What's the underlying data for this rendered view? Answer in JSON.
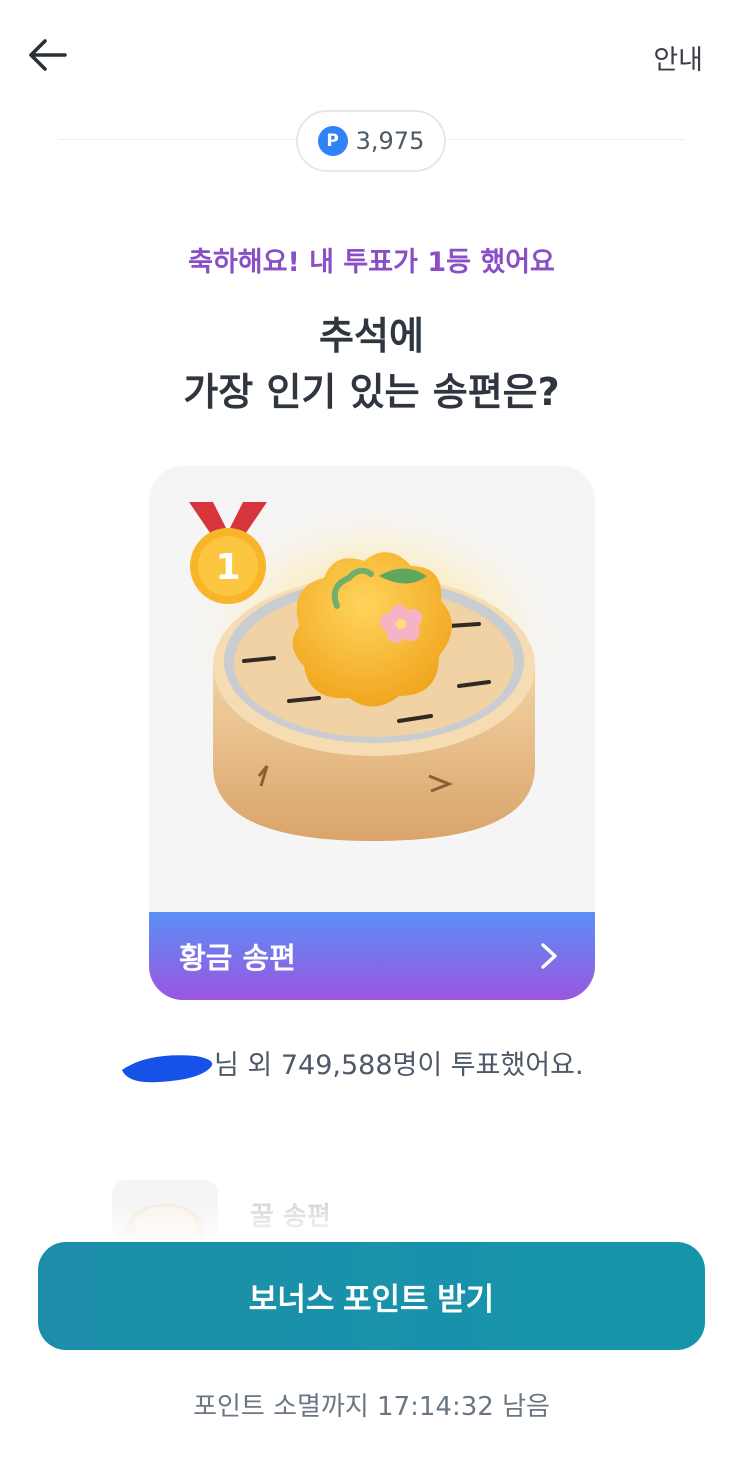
{
  "header": {
    "back_icon": "arrow-left-icon",
    "guide_label": "안내"
  },
  "points": {
    "icon": "P",
    "icon_color": "#3182f6",
    "value": "3,975"
  },
  "result": {
    "congrats_text": "축하해요! 내 투표가 1등 했어요",
    "question_line1": "추석에",
    "question_line2": "가장 인기 있는 송편은?"
  },
  "winner": {
    "rank": "1",
    "medal_icon": "gold-medal-icon",
    "label": "황금 송편",
    "chevron_icon": "chevron-right-icon",
    "bar_gradient": [
      "#5b8ff6",
      "#9a56e0"
    ]
  },
  "voters": {
    "suffix": "님 외 749,588명이 투표했어요."
  },
  "next_item": {
    "label": "꿀 송편"
  },
  "cta": {
    "label": "보너스 포인트 받기",
    "color": "#1d8ea9"
  },
  "footer": {
    "expire_text": "포인트 소멸까지 17:14:32 남음"
  },
  "colors": {
    "accent_purple": "#8a4fc5",
    "text_dark": "#2f3640"
  }
}
